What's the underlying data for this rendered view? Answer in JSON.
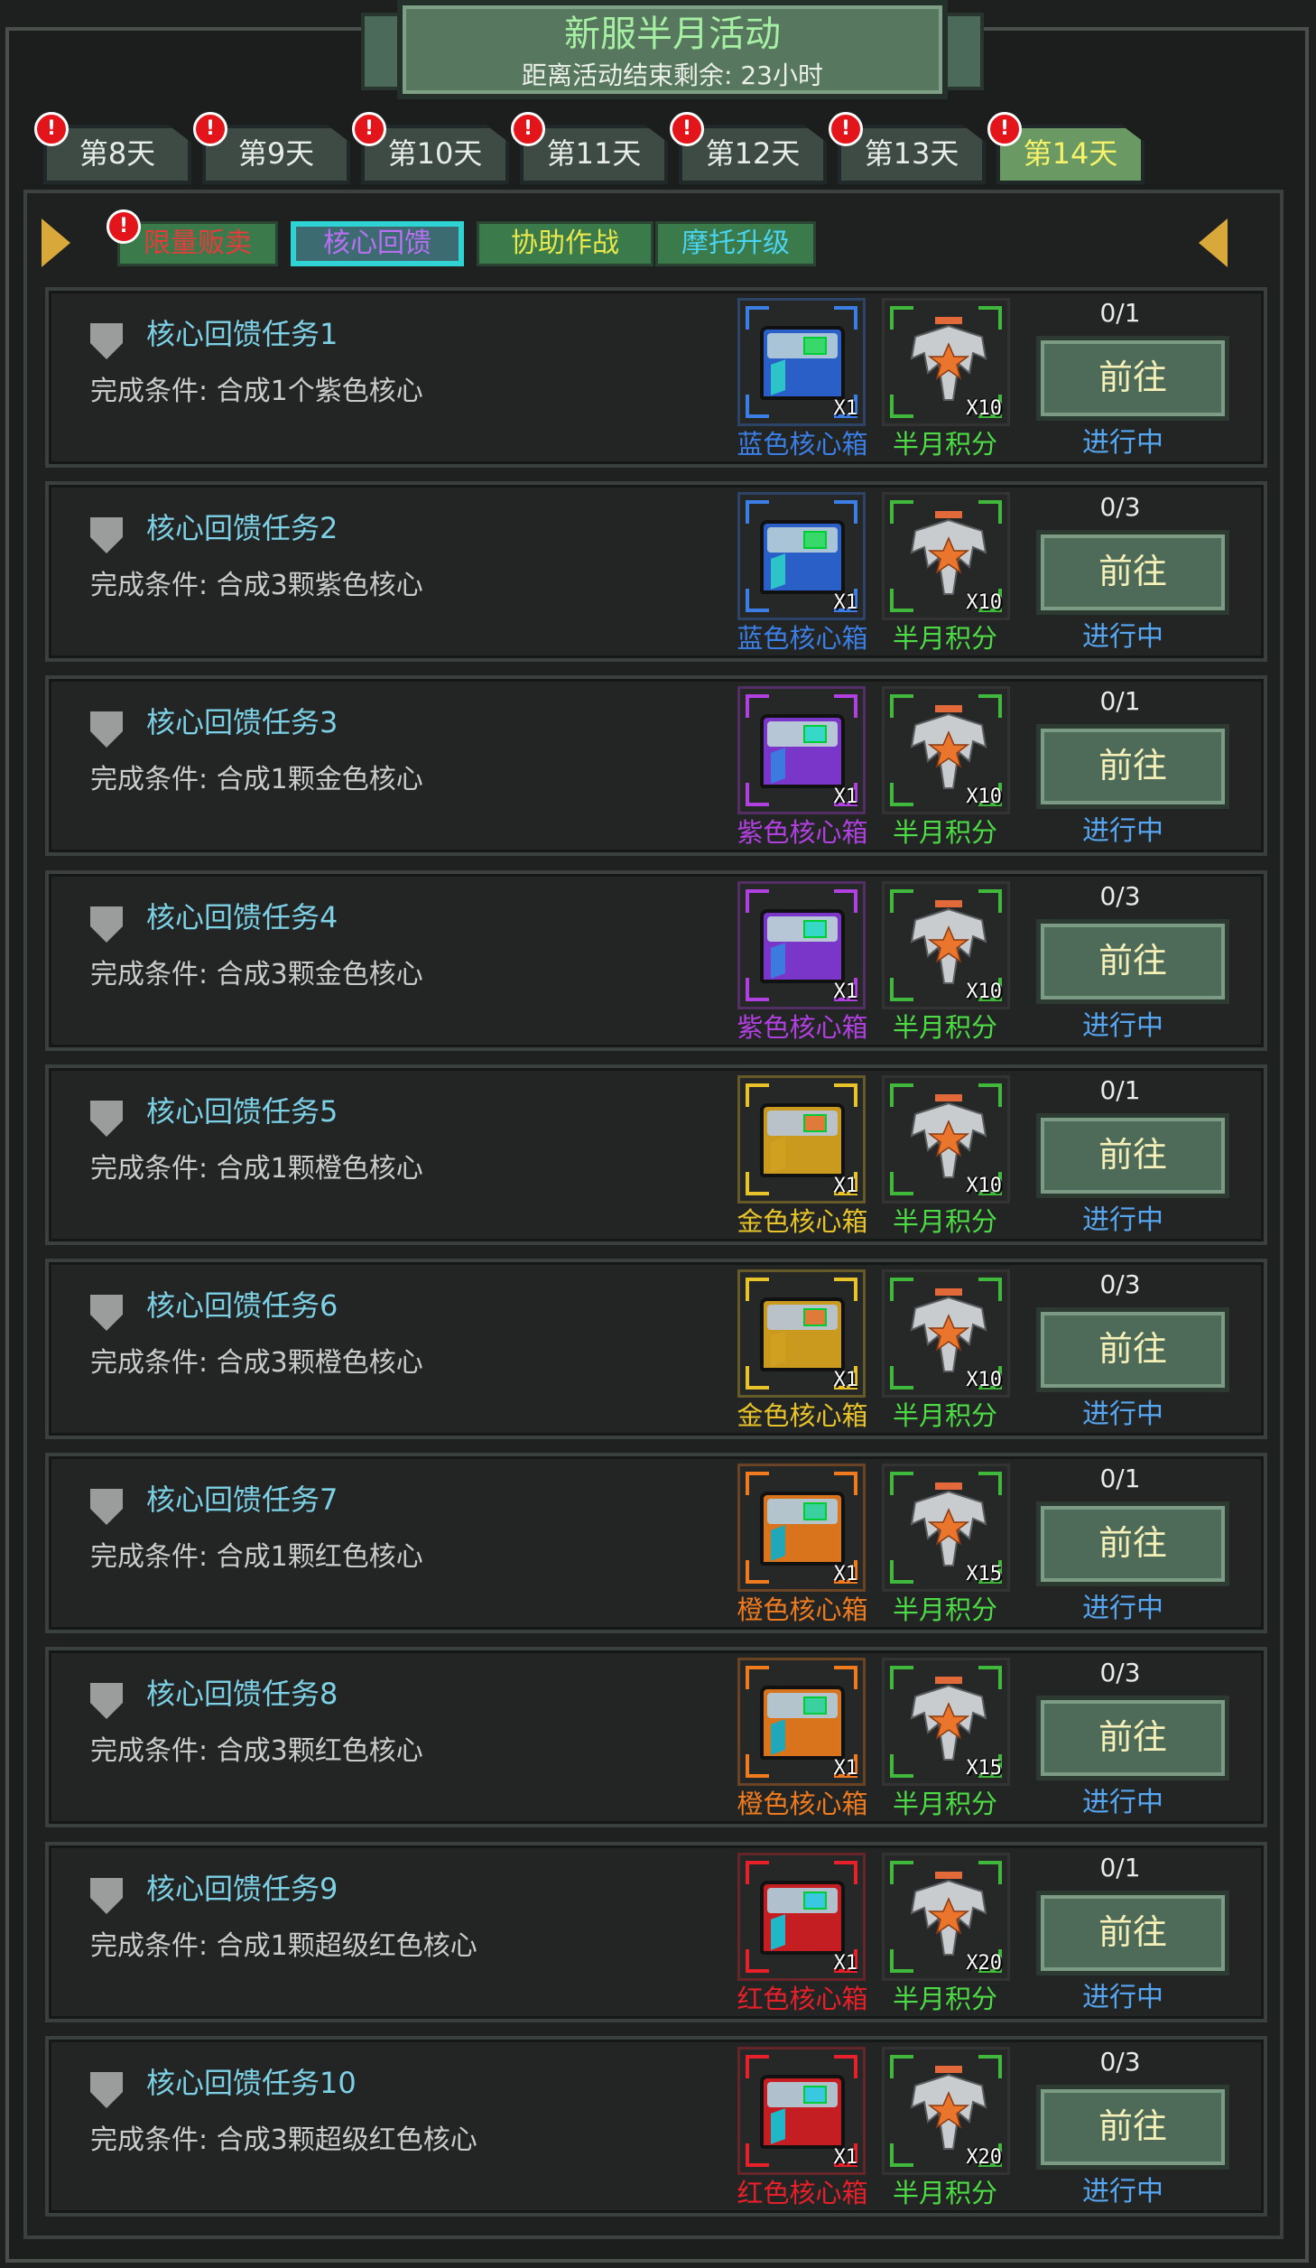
{
  "header": {
    "title": "新服半月活动",
    "subtitle": "距离活动结束剩余: 23小时"
  },
  "day_tabs": [
    {
      "label": "第8天",
      "alert": "!",
      "active": false
    },
    {
      "label": "第9天",
      "alert": "!",
      "active": false
    },
    {
      "label": "第10天",
      "alert": "!",
      "active": false
    },
    {
      "label": "第11天",
      "alert": "!",
      "active": false
    },
    {
      "label": "第12天",
      "alert": "!",
      "active": false
    },
    {
      "label": "第13天",
      "alert": "!",
      "active": false
    },
    {
      "label": "第14天",
      "alert": "!",
      "active": true
    }
  ],
  "sub_tabs": [
    {
      "label": "限量贩卖",
      "color": "#e83a3a",
      "alert": "!",
      "active": false
    },
    {
      "label": "核心回馈",
      "color": "#b870f2",
      "active": true
    },
    {
      "label": "协助作战",
      "color": "#e9e84c",
      "active": false
    },
    {
      "label": "摩托升级",
      "color": "#4ad4f2",
      "active": false
    }
  ],
  "colors": {
    "blue": "#3b7fe6",
    "purple": "#b040e0",
    "gold": "#e8c42a",
    "orange": "#f07a1e",
    "red": "#e8202a"
  },
  "tasks": [
    {
      "name": "核心回馈任务1",
      "condition": "完成条件: 合成1个紫色核心",
      "box_label": "蓝色核心箱",
      "box_color": "blue",
      "box_count": "X1",
      "points_label": "半月积分",
      "points_count": "X10",
      "progress": "0/1",
      "button": "前往",
      "status": "进行中"
    },
    {
      "name": "核心回馈任务2",
      "condition": "完成条件: 合成3颗紫色核心",
      "box_label": "蓝色核心箱",
      "box_color": "blue",
      "box_count": "X1",
      "points_label": "半月积分",
      "points_count": "X10",
      "progress": "0/3",
      "button": "前往",
      "status": "进行中"
    },
    {
      "name": "核心回馈任务3",
      "condition": "完成条件: 合成1颗金色核心",
      "box_label": "紫色核心箱",
      "box_color": "purple",
      "box_count": "X1",
      "points_label": "半月积分",
      "points_count": "X10",
      "progress": "0/1",
      "button": "前往",
      "status": "进行中"
    },
    {
      "name": "核心回馈任务4",
      "condition": "完成条件: 合成3颗金色核心",
      "box_label": "紫色核心箱",
      "box_color": "purple",
      "box_count": "X1",
      "points_label": "半月积分",
      "points_count": "X10",
      "progress": "0/3",
      "button": "前往",
      "status": "进行中"
    },
    {
      "name": "核心回馈任务5",
      "condition": "完成条件: 合成1颗橙色核心",
      "box_label": "金色核心箱",
      "box_color": "gold",
      "box_count": "X1",
      "points_label": "半月积分",
      "points_count": "X10",
      "progress": "0/1",
      "button": "前往",
      "status": "进行中"
    },
    {
      "name": "核心回馈任务6",
      "condition": "完成条件: 合成3颗橙色核心",
      "box_label": "金色核心箱",
      "box_color": "gold",
      "box_count": "X1",
      "points_label": "半月积分",
      "points_count": "X10",
      "progress": "0/3",
      "button": "前往",
      "status": "进行中"
    },
    {
      "name": "核心回馈任务7",
      "condition": "完成条件: 合成1颗红色核心",
      "box_label": "橙色核心箱",
      "box_color": "orange",
      "box_count": "X1",
      "points_label": "半月积分",
      "points_count": "X15",
      "progress": "0/1",
      "button": "前往",
      "status": "进行中"
    },
    {
      "name": "核心回馈任务8",
      "condition": "完成条件: 合成3颗红色核心",
      "box_label": "橙色核心箱",
      "box_color": "orange",
      "box_count": "X1",
      "points_label": "半月积分",
      "points_count": "X15",
      "progress": "0/3",
      "button": "前往",
      "status": "进行中"
    },
    {
      "name": "核心回馈任务9",
      "condition": "完成条件: 合成1颗超级红色核心",
      "box_label": "红色核心箱",
      "box_color": "red",
      "box_count": "X1",
      "points_label": "半月积分",
      "points_count": "X20",
      "progress": "0/1",
      "button": "前往",
      "status": "进行中"
    },
    {
      "name": "核心回馈任务10",
      "condition": "完成条件: 合成3颗超级红色核心",
      "box_label": "红色核心箱",
      "box_color": "red",
      "box_count": "X1",
      "points_label": "半月积分",
      "points_count": "X20",
      "progress": "0/3",
      "button": "前往",
      "status": "进行中"
    }
  ],
  "icons": {
    "task": "shield-icon",
    "box": "core-chest-icon",
    "points": "eagle-points-icon",
    "nav_left": "triangle-right-icon",
    "nav_right": "triangle-left-icon",
    "alert": "alert-icon"
  }
}
